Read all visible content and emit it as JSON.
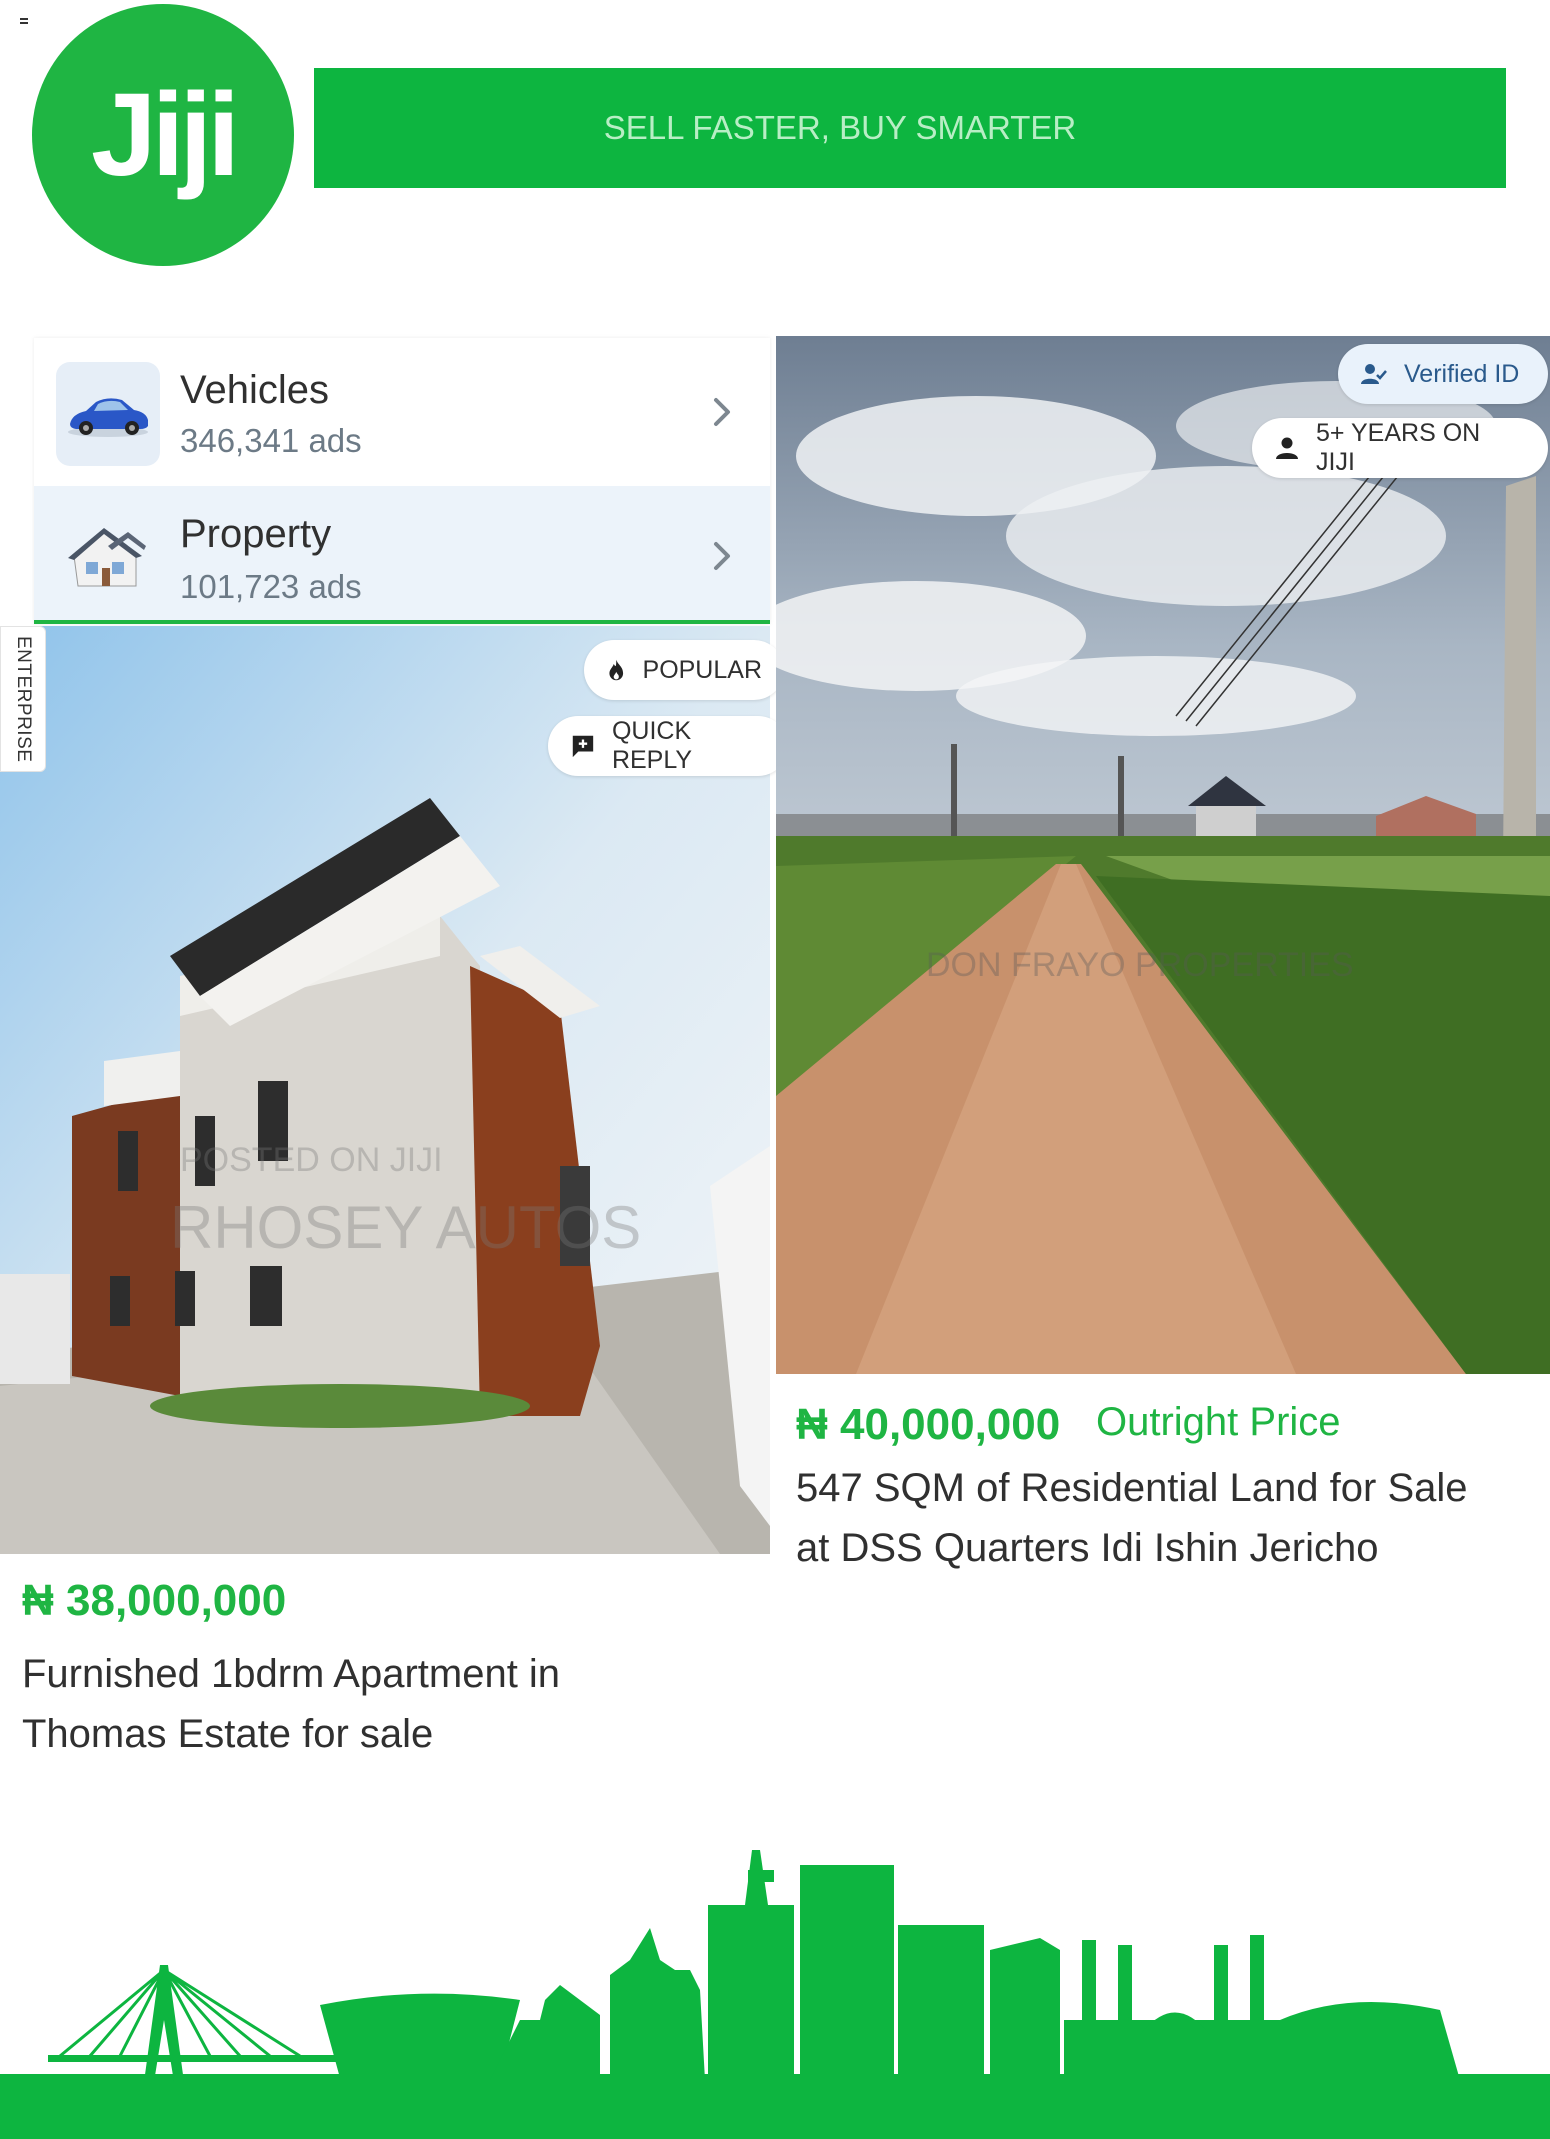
{
  "header": {
    "logo_text": "Jiji",
    "tagline": "SELL FASTER, BUY SMARTER",
    "brand_color": "#1fb543"
  },
  "categories": [
    {
      "title": "Vehicles",
      "count": "346,341 ads",
      "icon": "car-icon"
    },
    {
      "title": "Property",
      "count": "101,723 ads",
      "icon": "house-icon"
    }
  ],
  "ads": [
    {
      "price": "₦ 38,000,000",
      "title_line1": "Furnished 1bdrm Apartment in",
      "title_line2": "Thomas Estate for sale",
      "badges": [
        "POPULAR",
        "QUICK REPLY"
      ],
      "side_label": "ENTERPRISE",
      "watermark": "RHOSEY AUTOS"
    },
    {
      "price": "₦ 40,000,000",
      "price_note": "Outright Price",
      "title_line1": "547 SQM of Residential Land for Sale",
      "title_line2": "at DSS Quarters Idi Ishin Jericho",
      "badges": [
        "Verified ID",
        "5+ YEARS ON JIJI"
      ]
    }
  ]
}
